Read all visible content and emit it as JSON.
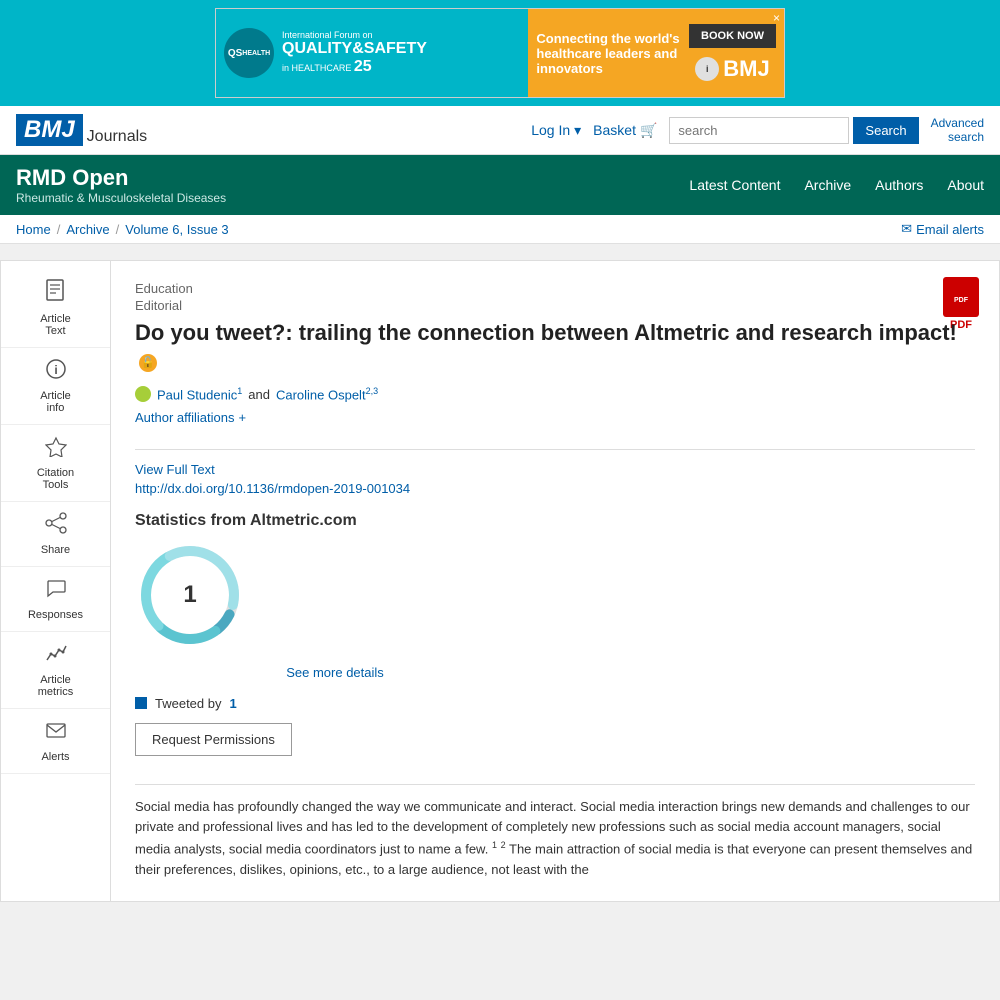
{
  "ad": {
    "left_logo": "QS",
    "left_title": "International Forum on\nQUALITY & SAFETY\nin HEALTHCARE 25",
    "right_text": "Connecting the world's healthcare leaders and innovators",
    "book_btn": "BOOK NOW",
    "bmj_label": "BMJ",
    "close_btn": "×"
  },
  "topnav": {
    "logo_text": "BMJ",
    "logo_subtext": "Journals",
    "login_label": "Log In",
    "basket_label": "Basket",
    "search_placeholder": "search",
    "search_btn": "Search",
    "advanced_search": "Advanced\nsearch"
  },
  "journal_header": {
    "title": "RMD Open",
    "subtitle": "Rheumatic & Musculoskeletal Diseases",
    "nav": [
      "Latest Content",
      "Archive",
      "Authors",
      "About"
    ]
  },
  "breadcrumb": {
    "home": "Home",
    "archive": "Archive",
    "volume": "Volume 6, Issue 3",
    "email_alerts": "Email alerts"
  },
  "sidebar": {
    "items": [
      {
        "id": "article-text",
        "icon": "📄",
        "label": "Article\nText"
      },
      {
        "id": "article-info",
        "icon": "ℹ️",
        "label": "Article\ninfo"
      },
      {
        "id": "citation-tools",
        "icon": "👍",
        "label": "Citation\nTools"
      },
      {
        "id": "share",
        "icon": "↗",
        "label": "Share"
      },
      {
        "id": "responses",
        "icon": "💬",
        "label": "Responses"
      },
      {
        "id": "article-metrics",
        "icon": "📊",
        "label": "Article\nmetrics"
      },
      {
        "id": "alerts",
        "icon": "✉",
        "label": "Alerts"
      }
    ]
  },
  "article": {
    "section": "Education",
    "type": "Editorial",
    "title": "Do you tweet?: trailing the connection between Altmetric and research impact!",
    "open_access": "🔓",
    "authors": [
      {
        "name": "Paul Studenic",
        "sup": "1",
        "orcid": true
      },
      {
        "name": "Caroline Ospelt",
        "sup": "2,3"
      }
    ],
    "author_affiliations_label": "Author affiliations",
    "view_full_text": "View Full Text",
    "doi": "http://dx.doi.org/10.1136/rmdopen-2019-001034",
    "pdf_label": "PDF",
    "stats_title": "Statistics from Altmetric.com",
    "altmetric_score": "1",
    "see_more": "See more details",
    "tweeted_label": "Tweeted by",
    "tweeted_count": "1",
    "request_permissions_btn": "Request Permissions",
    "body_text": "Social media has profoundly changed the way we communicate and interact. Social media interaction brings new demands and challenges to our private and professional lives and has led to the development of completely new professions such as social media account managers, social media analysts, social media coordinators just to name a few.",
    "body_cont": "The main attraction of social media is that everyone can present themselves and their preferences, dislikes, opinions, etc., to a large audience, not least with the"
  }
}
